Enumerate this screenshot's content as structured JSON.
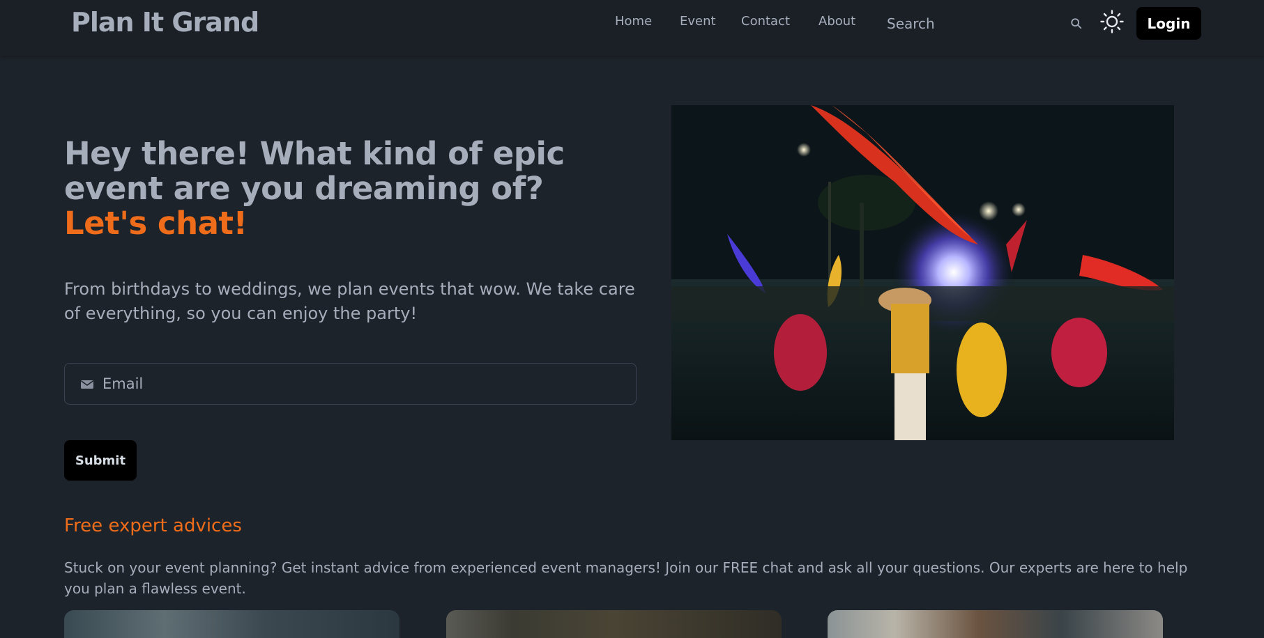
{
  "navbar": {
    "brand": "Plan It Grand",
    "links": [
      "Home",
      "Event",
      "Contact",
      "About"
    ],
    "search_placeholder": "Search",
    "login_label": "Login"
  },
  "hero": {
    "heading_line": "Hey there! What kind of epic event are you dreaming of?",
    "heading_accent": "Let's chat!",
    "subtext": "From birthdays to weddings, we plan events that wow. We take care of everything, so you can enjoy the party!",
    "email_placeholder": "Email",
    "submit_label": "Submit",
    "image_description": "Festival dancers waving red flags at night"
  },
  "advice": {
    "title": "Free expert advices",
    "text": "Stuck on your event planning? Get instant advice from experienced event managers! Join our FREE chat and ask all your questions. Our experts are here to help you plan a flawless event."
  },
  "colors": {
    "background": "#1d232a",
    "accent": "#ef6c1a",
    "text": "#a6adbb",
    "button": "#000000"
  },
  "icons": [
    "search-icon",
    "sun-icon",
    "mail-icon"
  ]
}
